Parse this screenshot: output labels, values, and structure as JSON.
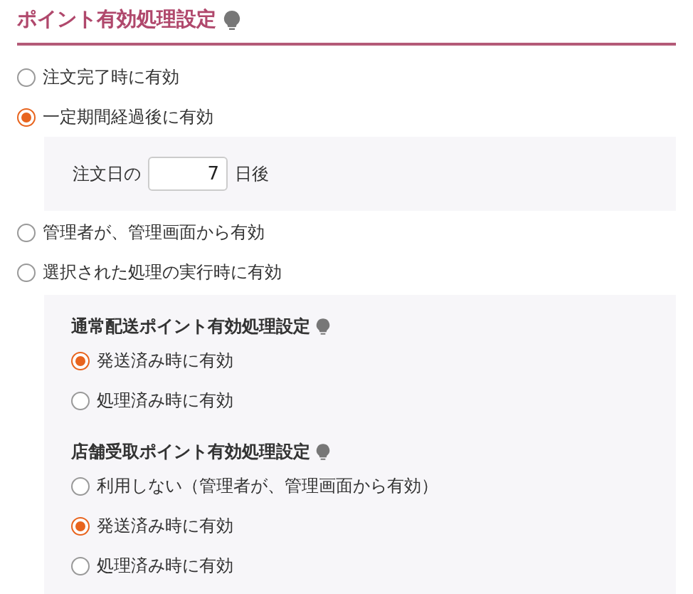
{
  "title": "ポイント有効処理設定",
  "options": [
    {
      "label": "注文完了時に有効",
      "selected": false
    },
    {
      "label": "一定期間経過後に有効",
      "selected": true,
      "days_field": {
        "prefix": "注文日の",
        "value": "7",
        "suffix": "日後"
      }
    },
    {
      "label": "管理者が、管理画面から有効",
      "selected": false
    },
    {
      "label": "選択された処理の実行時に有効",
      "selected": false,
      "groups": [
        {
          "title": "通常配送ポイント有効処理設定",
          "options": [
            {
              "label": "発送済み時に有効",
              "selected": true
            },
            {
              "label": "処理済み時に有効",
              "selected": false
            }
          ]
        },
        {
          "title": "店舗受取ポイント有効処理設定",
          "options": [
            {
              "label": "利用しない（管理者が、管理画面から有効）",
              "selected": false
            },
            {
              "label": "発送済み時に有効",
              "selected": true
            },
            {
              "label": "処理済み時に有効",
              "selected": false
            }
          ]
        }
      ]
    }
  ]
}
